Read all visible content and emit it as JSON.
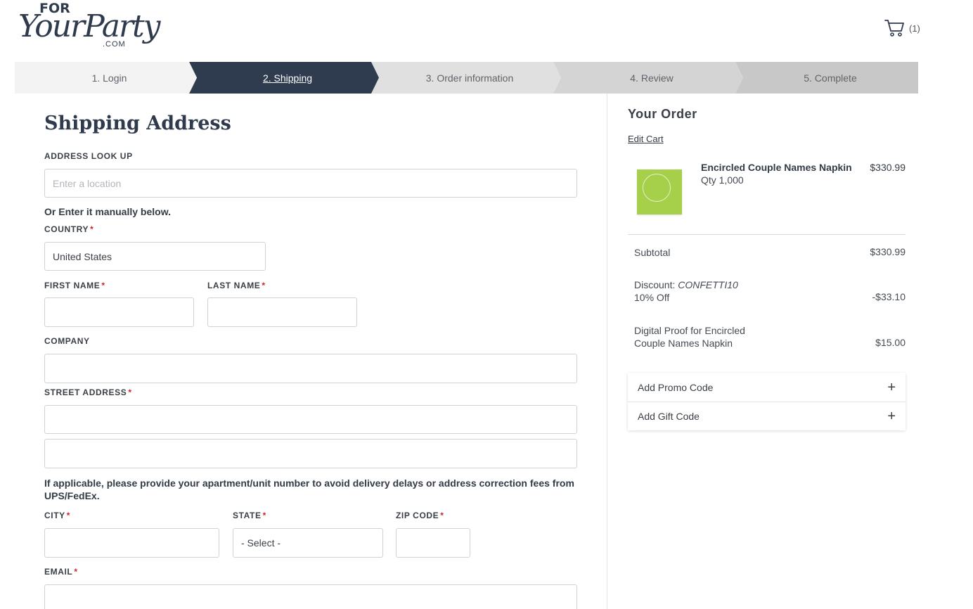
{
  "header": {
    "logo": {
      "line1": "FOR",
      "line2": "YourParty",
      "line3": ".COM"
    },
    "cart_count": "(1)"
  },
  "steps": [
    {
      "label": "1. Login",
      "state": "done"
    },
    {
      "label": "2. Shipping",
      "state": "active"
    },
    {
      "label": "3. Order information",
      "state": "pending"
    },
    {
      "label": "4. Review",
      "state": "pending"
    },
    {
      "label": "5. Complete",
      "state": "pending"
    }
  ],
  "form": {
    "title": "Shipping Address",
    "address_lookup": {
      "label": "ADDRESS LOOK UP",
      "placeholder": "Enter a location"
    },
    "manual_note": "Or Enter it manually below.",
    "country": {
      "label": "COUNTRY",
      "value": "United States"
    },
    "first_name": {
      "label": "FIRST NAME"
    },
    "last_name": {
      "label": "LAST NAME"
    },
    "company": {
      "label": "COMPANY"
    },
    "street": {
      "label": "STREET ADDRESS"
    },
    "apt_note": "If applicable, please provide your apartment/unit number to avoid delivery delays or address correction fees from UPS/FedEx.",
    "city": {
      "label": "CITY"
    },
    "state": {
      "label": "STATE",
      "value": "- Select -"
    },
    "zip": {
      "label": "ZIP CODE"
    },
    "email": {
      "label": "EMAIL"
    },
    "required_marker": "*"
  },
  "order": {
    "title": "Your Order",
    "edit_cart": "Edit Cart",
    "item": {
      "name": "Encircled Couple Names Napkin",
      "qty": "Qty 1,000",
      "price": "$330.99"
    },
    "subtotal": {
      "label": "Subtotal",
      "value": "$330.99"
    },
    "discount": {
      "label": "Discount:",
      "code": "CONFETTI10",
      "detail": "10% Off",
      "value": "-$33.10"
    },
    "proof": {
      "line1": "Digital Proof for Encircled",
      "line2": "Couple Names Napkin",
      "value": "$15.00"
    },
    "promo_label": "Add Promo Code",
    "gift_label": "Add Gift Code",
    "plus_glyph": "+"
  },
  "colors": {
    "navy": "#2f3c50",
    "required": "#c62828",
    "thumb": "#a6cf4a"
  },
  "icons": {
    "cart": "cart-icon",
    "plus": "plus-icon"
  }
}
